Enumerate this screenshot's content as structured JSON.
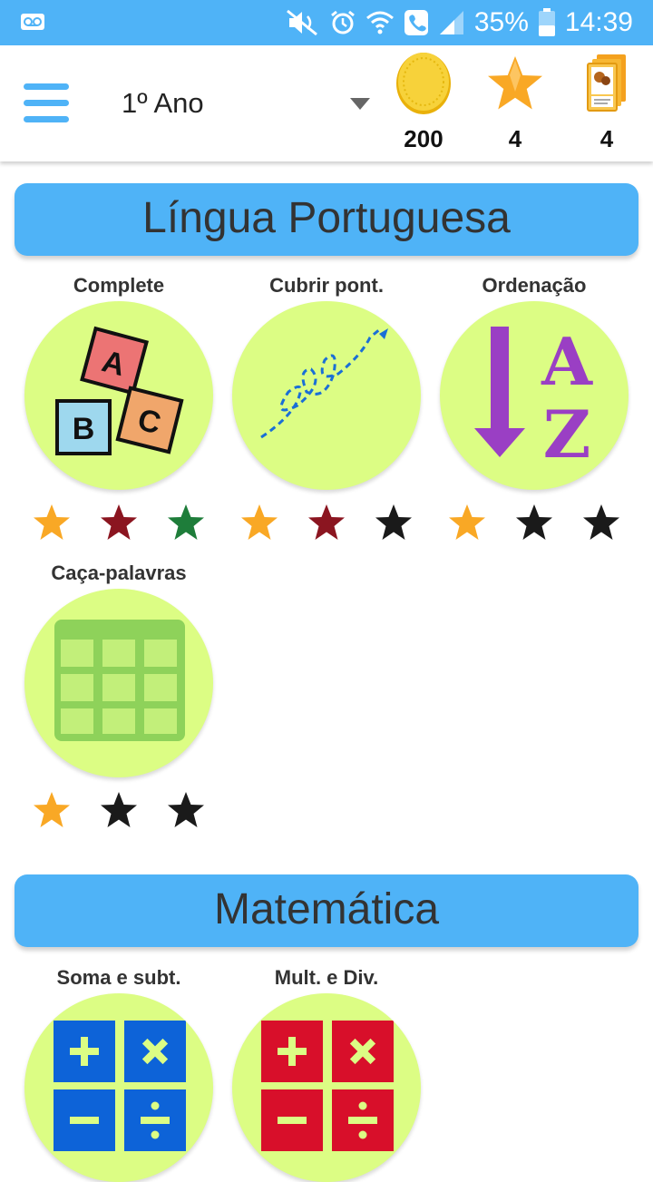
{
  "status_bar": {
    "battery": "35%",
    "time": "14:39"
  },
  "app_bar": {
    "grade": "1º Ano",
    "coins": "200",
    "stars": "4",
    "cards": "4"
  },
  "sections": [
    {
      "title": "Língua Portuguesa",
      "activities": [
        {
          "label": "Complete",
          "icon": "abc-blocks-icon",
          "stars": [
            "gold",
            "red",
            "green"
          ]
        },
        {
          "label": "Cubrir pont.",
          "icon": "dotted-trace-icon",
          "stars": [
            "gold",
            "red",
            "black"
          ]
        },
        {
          "label": "Ordenação",
          "icon": "sort-az-icon",
          "stars": [
            "gold",
            "black",
            "black"
          ]
        },
        {
          "label": "Caça-palavras",
          "icon": "word-grid-icon",
          "stars": [
            "gold",
            "black",
            "black"
          ]
        }
      ]
    },
    {
      "title": "Matemática",
      "activities": [
        {
          "label": "Soma e subt.",
          "icon": "math-blue-icon"
        },
        {
          "label": "Mult. e Div.",
          "icon": "math-red-icon"
        }
      ]
    }
  ],
  "colors": {
    "primary": "#4fb3f7",
    "circle": "#dcfd84",
    "star_gold": "#f9a825",
    "star_red": "#8b1520",
    "star_green": "#1e7d3a",
    "star_black": "#1a1a1a"
  }
}
